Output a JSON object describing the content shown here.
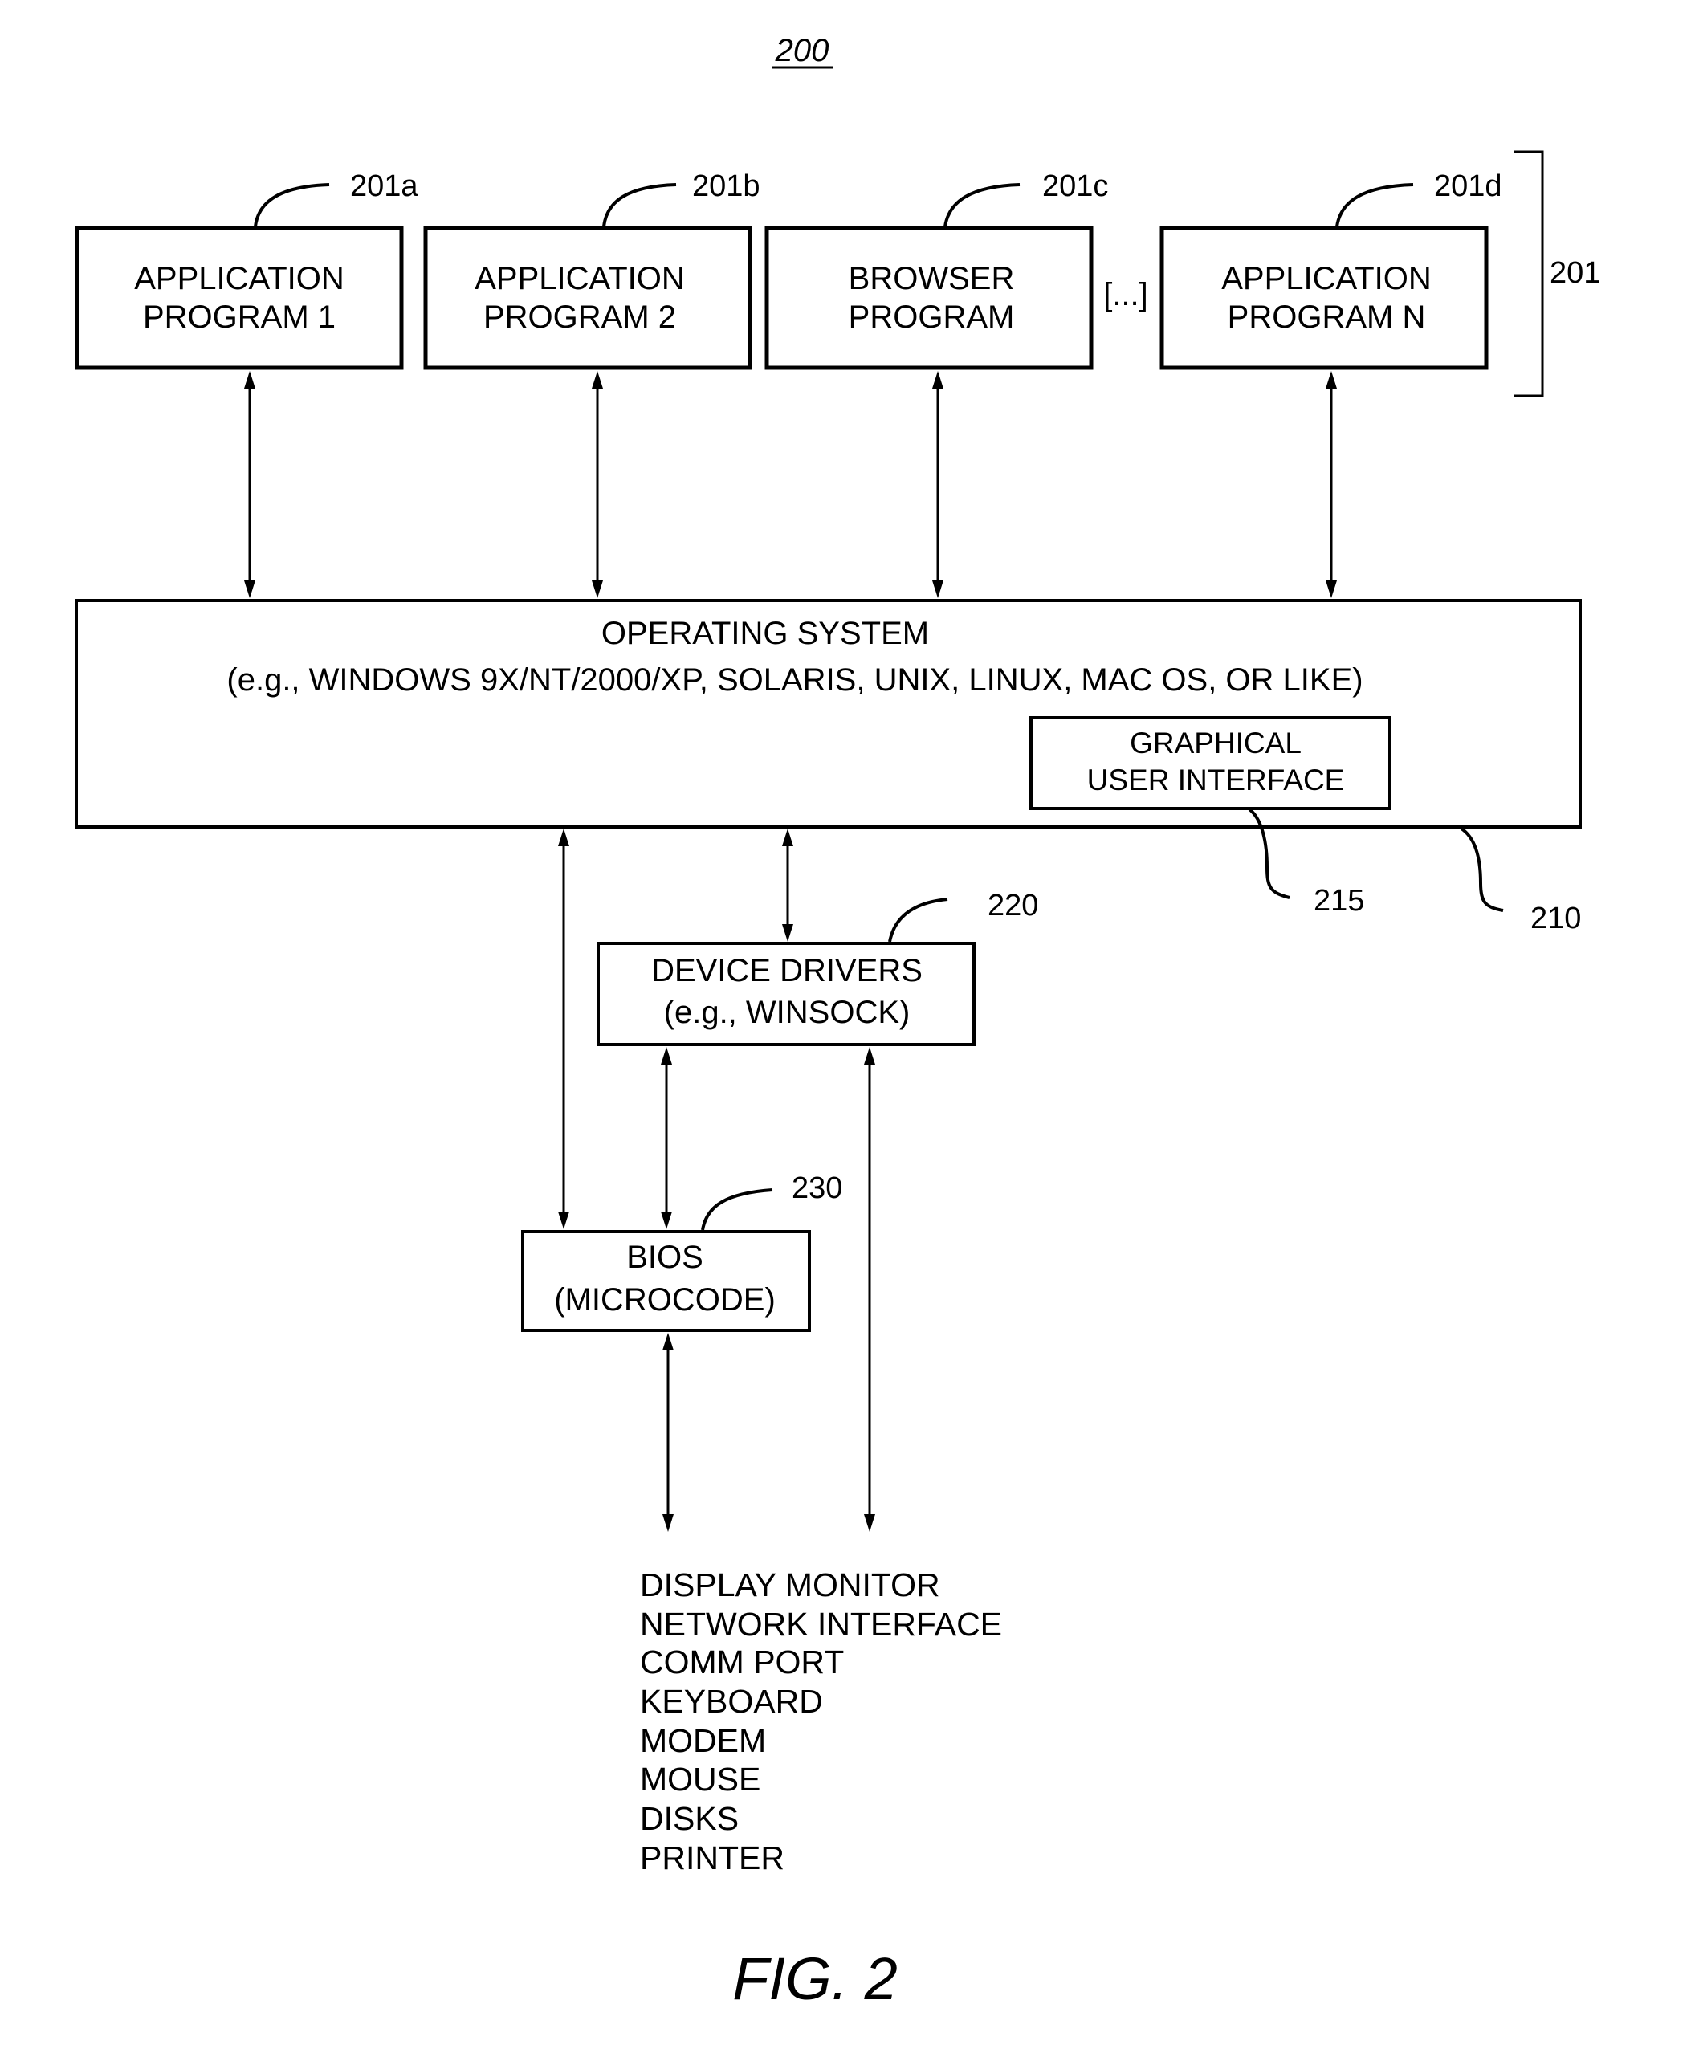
{
  "figure": {
    "number": "200",
    "caption": "FIG. 2"
  },
  "group_201": {
    "ref": "201",
    "ellipsis": "[...]",
    "programs": [
      {
        "ref": "201a",
        "line1": "APPLICATION",
        "line2": "PROGRAM 1"
      },
      {
        "ref": "201b",
        "line1": "APPLICATION",
        "line2": "PROGRAM 2"
      },
      {
        "ref": "201c",
        "line1": "BROWSER",
        "line2": "PROGRAM"
      },
      {
        "ref": "201d",
        "line1": "APPLICATION",
        "line2": "PROGRAM N"
      }
    ]
  },
  "operating_system": {
    "ref": "210",
    "title": "OPERATING SYSTEM",
    "examples": "(e.g., WINDOWS 9X/NT/2000/XP, SOLARIS, UNIX, LINUX, MAC OS, OR LIKE)",
    "gui": {
      "ref": "215",
      "line1": "GRAPHICAL",
      "line2": "USER INTERFACE"
    }
  },
  "device_drivers": {
    "ref": "220",
    "line1": "DEVICE DRIVERS",
    "line2": "(e.g., WINSOCK)"
  },
  "bios": {
    "ref": "230",
    "line1": "BIOS",
    "line2": "(MICROCODE)"
  },
  "peripherals": [
    "DISPLAY MONITOR",
    "NETWORK INTERFACE",
    "COMM PORT",
    "KEYBOARD",
    "MODEM",
    "MOUSE",
    "DISKS",
    "PRINTER"
  ]
}
